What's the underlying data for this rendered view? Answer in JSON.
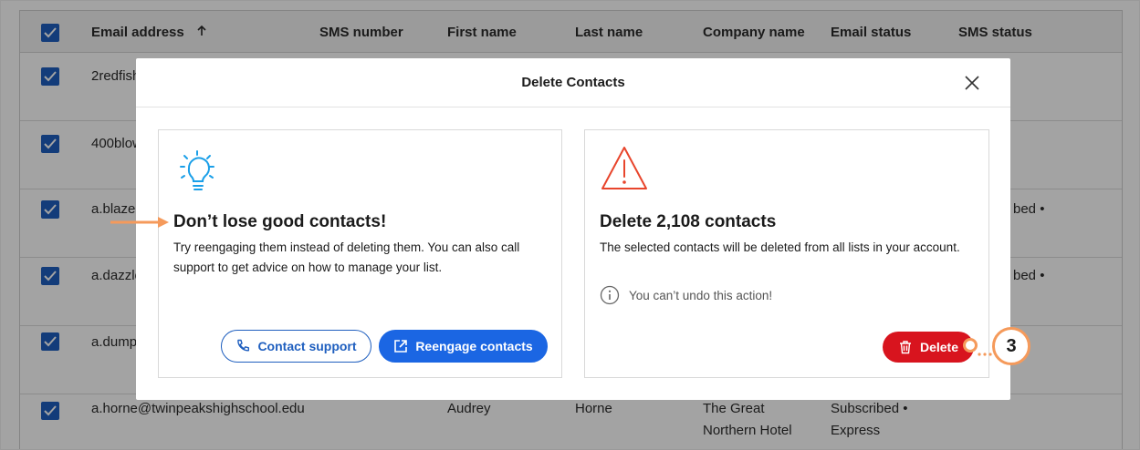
{
  "table": {
    "headers": {
      "email": "Email address",
      "sms": "SMS number",
      "first": "First name",
      "last": "Last name",
      "company": "Company name",
      "email_status": "Email status",
      "sms_status": "SMS status"
    },
    "rows": [
      {
        "email": "2redfish"
      },
      {
        "email": "400blow"
      },
      {
        "email": "a.blaze",
        "email_status": "bed •"
      },
      {
        "email": "a.dazzle",
        "email_status": "bed •"
      },
      {
        "email": "a.dump"
      },
      {
        "email": "a.horne@twinpeakshighschool.edu",
        "first": "Audrey",
        "last": "Horne",
        "company_1": "The Great",
        "company_2": "Northern Hotel",
        "status_1": "Subscribed •",
        "status_2": "Express"
      }
    ]
  },
  "modal": {
    "title": "Delete Contacts",
    "left_card": {
      "title": "Don’t lose good contacts!",
      "body": "Try reengaging them instead of deleting them. You can also call support to get advice on how to manage your list.",
      "contact_support": "Contact support",
      "reengage": "Reengage contacts"
    },
    "right_card": {
      "title": "Delete 2,108 contacts",
      "body": "The selected contacts will be deleted from all lists in your account.",
      "info": "You can’t undo this action!",
      "delete": "Delete"
    }
  },
  "annotation": {
    "callout_number": "3"
  },
  "colors": {
    "primary": "#1b66e3",
    "danger": "#d8141e",
    "warning_icon": "#e8452c",
    "bulb_icon": "#1a9fe8",
    "annotation": "#f59a5b",
    "checkbox": "#1f5fbf"
  },
  "icons": [
    "sort-up-icon",
    "close-icon",
    "lightbulb-icon",
    "warning-icon",
    "info-icon",
    "phone-icon",
    "external-link-icon",
    "trash-icon",
    "checkbox-checked-icon"
  ]
}
